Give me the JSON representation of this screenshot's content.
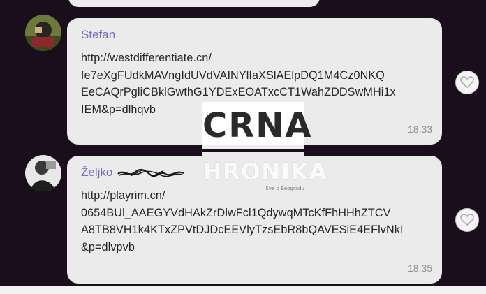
{
  "messages": [
    {
      "sender": "Stefan",
      "text": "http://westdifferentiate.cn/\nfe7eXgFUdkMAVngIdUVdVAINYlIaXSlAElpDQ1M4Cz0NKQ\nEeCAQrPgliCBklGwthG1YDExEOATxcCT1WahZDDSwMHi1x\nIEM&p=dlhqvb",
      "time": "18:33",
      "avatar_icon": "user-avatar-icon",
      "reaction_icon": "heart-icon"
    },
    {
      "sender": "Željko",
      "text": "http://playrim.cn/\n0654BUl_AAEGYVdHAkZrDlwFcl1QdywqMTcKfFhHHhZTCV\nA8TB8VH1k4KTxZPVtDJDcEEVlyTzsEbR8bQAVESiE4EFlvNkI\n&p=dlvpvb",
      "time": "18:35",
      "avatar_icon": "user-avatar-icon",
      "reaction_icon": "heart-icon"
    }
  ],
  "watermark": {
    "line1": "CRNA",
    "line2": "HRONIKA",
    "subtitle": "Sve o Beogradu"
  },
  "colors": {
    "background": "#1b0e1c",
    "bubble": "#ebebeb",
    "sender_name": "#7a67c8",
    "timestamp": "#8f8f8f"
  }
}
